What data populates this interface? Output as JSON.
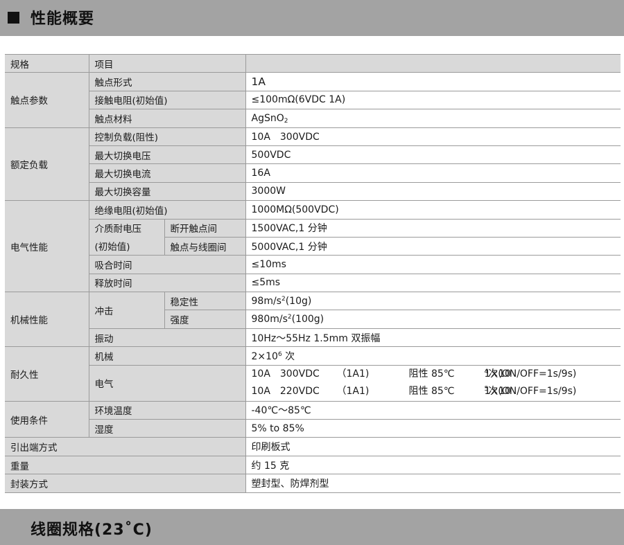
{
  "header": {
    "title": "性能概要"
  },
  "footer": {
    "title": "线圈规格(23˚C)"
  },
  "table": {
    "col_spec": "规格",
    "col_item": "项目",
    "contact": {
      "group": "触点参数",
      "form_label": "触点形式",
      "form_value": "1A",
      "resistance_label": "接触电阻(初始值)",
      "resistance_value": "≤100mΩ(6VDC 1A)",
      "material_label": "触点材料",
      "material_value": "AgSnO",
      "material_sub": "2"
    },
    "rated": {
      "group": "额定负载",
      "ctrl_label": "控制负载(阻性)",
      "ctrl_value": "10A　300VDC",
      "maxv_label": "最大切换电压",
      "maxv_value": "500VDC",
      "maxi_label": "最大切换电流",
      "maxi_value": "16A",
      "maxp_label": "最大切换容量",
      "maxp_value": "3000W"
    },
    "electrical": {
      "group": "电气性能",
      "insul_label": "绝缘电阻(初始值)",
      "insul_value": "1000MΩ(500VDC)",
      "diel_label_1": "介质耐电压",
      "diel_label_2": "(初始值)",
      "open_label": "断开触点间",
      "open_value": "1500VAC,1 分钟",
      "coil_label": "触点与线圈间",
      "coil_value": "5000VAC,1 分钟",
      "op_label": "吸合时间",
      "op_value": "≤10ms",
      "rel_label": "释放时间",
      "rel_value": "≤5ms"
    },
    "mechanical": {
      "group": "机械性能",
      "shock_label": "冲击",
      "stab_label": "稳定性",
      "stab_value_a": "98m/s",
      "stab_sup": "2",
      "stab_value_b": "(10g)",
      "str_label": "强度",
      "str_value_a": "980m/s",
      "str_sup": "2",
      "str_value_b": "(100g)",
      "vib_label": "振动",
      "vib_value": "10Hz～55Hz 1.5mm  双振幅"
    },
    "durability": {
      "group": "耐久性",
      "mech_label": "机械",
      "mech_value_a": "2×10",
      "mech_sup": "6",
      "mech_value_b": " 次",
      "elec_label": "电气",
      "line1": {
        "load": "10A　300VDC",
        "mode": "（1A1)",
        "type": "阻性 85℃",
        "life_a": "1×10",
        "life_sup": "4",
        "life_b": " 次(ON/OFF=1s/9s)"
      },
      "line2": {
        "load": "10A　220VDC",
        "mode": "（1A1)",
        "type": "阻性 85℃",
        "life_a": "1×10",
        "life_sup": "5",
        "life_b": " 次(ON/OFF=1s/9s)"
      }
    },
    "conditions": {
      "group": "使用条件",
      "temp_label": "环境温度",
      "temp_value": "-40℃～85℃",
      "hum_label": "湿度",
      "hum_value": "5% to 85%"
    },
    "terminal_label": "引出端方式",
    "terminal_value": "印刷板式",
    "weight_label": "重量",
    "weight_value": "约 15 克",
    "package_label": "封装方式",
    "package_value": "塑封型、防焊剂型"
  }
}
